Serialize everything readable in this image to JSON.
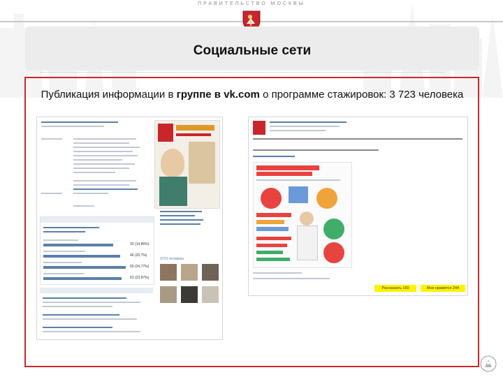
{
  "header": {
    "org_name": "ПРАВИТЕЛЬСТВО МОСКВЫ",
    "emblem_icon": "moscow-coat-of-arms-icon"
  },
  "slide": {
    "title": "Социальные сети",
    "subtitle_pre": "Публикация информации в ",
    "subtitle_bold": "группе в vk.com",
    "subtitle_post": " о программе стажировок: 3 723 человека"
  },
  "colors": {
    "accent_red": "#c9262c",
    "title_bar": "#ececec",
    "vk_blue": "#5b7fa8",
    "highlight_yellow": "#fff200",
    "infographic_red": "#e8433f"
  },
  "screenshots": {
    "left": {
      "type": "vk-group-page",
      "poll_results": [
        "33 (14,86%)",
        "46 (20,7%)",
        "55 (24,77%)",
        "53 (23,87%)"
      ],
      "members_count": "3723 человека"
    },
    "right": {
      "type": "vk-wall-post",
      "poster_title": "СТАЖИРОВКА В ПРАВИТЕЛЬСТВЕ МОСКВЫ",
      "likes_label": "Мне нравится 244",
      "shares_label": "Рассказать 160"
    }
  },
  "footer": {
    "corner_logo_icon": "moscow-emblem-icon"
  }
}
